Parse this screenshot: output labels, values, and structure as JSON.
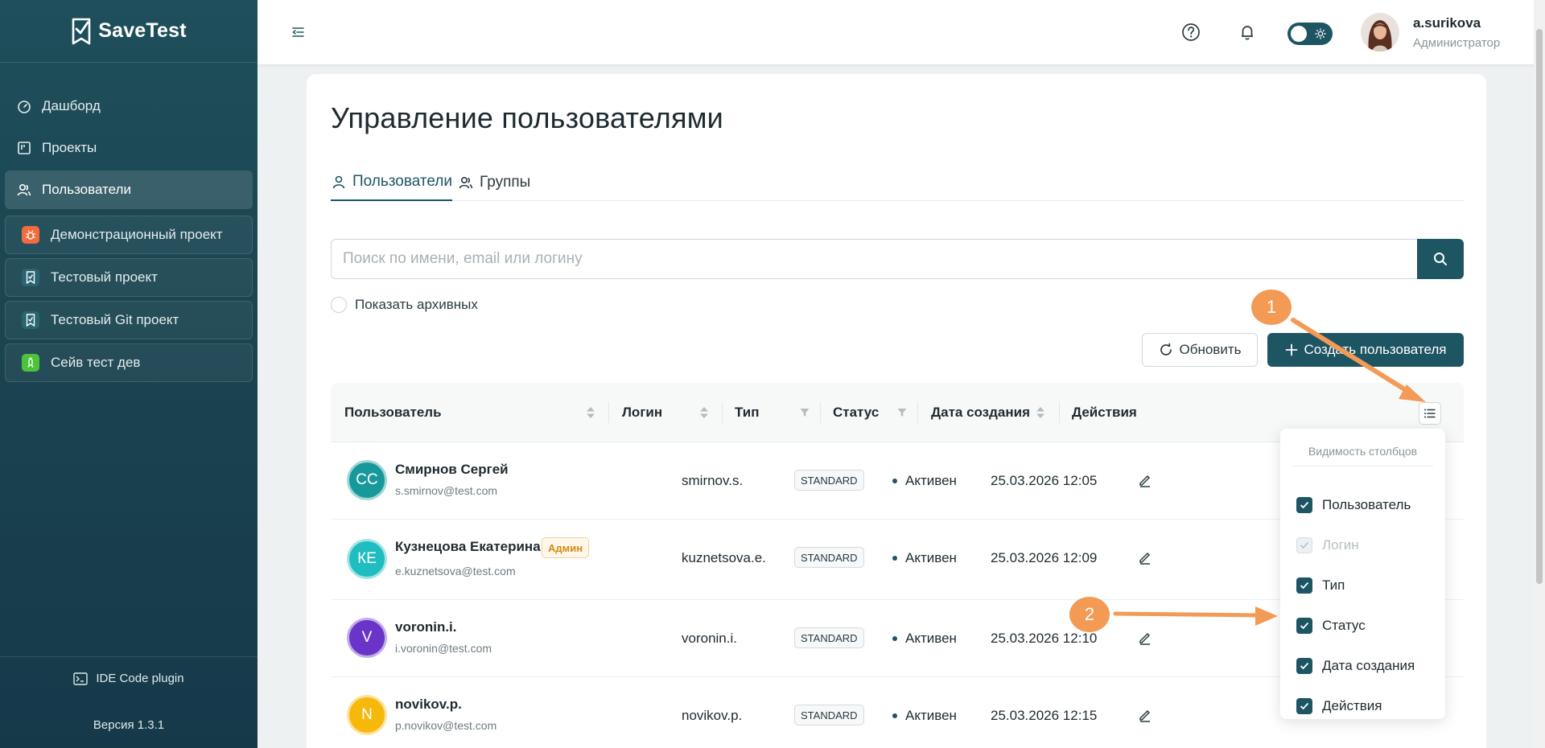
{
  "app": {
    "name": "SaveTest"
  },
  "sidebar": {
    "nav": [
      {
        "label": "Дашборд",
        "icon": "dashboard-icon"
      },
      {
        "label": "Проекты",
        "icon": "kanban-icon"
      },
      {
        "label": "Пользователи",
        "icon": "users-icon",
        "active": true
      }
    ],
    "projects": [
      {
        "label": "Демонстрационный проект",
        "icon": "bug-icon",
        "color": "#f26a3d"
      },
      {
        "label": "Тестовый проект",
        "icon": "checklist-icon",
        "color": "#2a6473"
      },
      {
        "label": "Тестовый Git проект",
        "icon": "checklist-icon",
        "color": "#2a6473"
      },
      {
        "label": "Сейв тест дев",
        "icon": "rocket-icon",
        "color": "#4cc33a"
      }
    ],
    "plugin_label": "IDE Code plugin",
    "version": "Версия 1.3.1"
  },
  "header": {
    "user": {
      "name": "a.surikova",
      "role": "Администратор"
    },
    "theme": "light"
  },
  "page": {
    "title": "Управление пользователями",
    "tabs": [
      {
        "label": "Пользователи",
        "active": true
      },
      {
        "label": "Группы"
      }
    ],
    "search": {
      "placeholder": "Поиск по имени, email или логину",
      "value": ""
    },
    "show_archived_label": "Показать архивных",
    "refresh_label": "Обновить",
    "create_label": "Создать пользователя"
  },
  "table": {
    "columns": [
      "Пользователь",
      "Логин",
      "Тип",
      "Статус",
      "Дата создания",
      "Действия"
    ],
    "rows": [
      {
        "initials": "СС",
        "avatar_color": "#17999b",
        "name": "Смирнов Сергей",
        "email": "s.smirnov@test.com",
        "admin": false,
        "login": "smirnov.s.",
        "type": "STANDARD",
        "status": "Активен",
        "created": "25.03.2026 12:05"
      },
      {
        "initials": "КЕ",
        "avatar_color": "#1fbcc0",
        "name": "Кузнецова Екатерина",
        "email": "e.kuznetsova@test.com",
        "admin": true,
        "admin_label": "Админ",
        "login": "kuznetsova.e.",
        "type": "STANDARD",
        "status": "Активен",
        "created": "25.03.2026 12:09"
      },
      {
        "initials": "V",
        "avatar_color": "#6a34c9",
        "name": "voronin.i.",
        "email": "i.voronin@test.com",
        "admin": false,
        "login": "voronin.i.",
        "type": "STANDARD",
        "status": "Активен",
        "created": "25.03.2026 12:10"
      },
      {
        "initials": "N",
        "avatar_color": "#f6b80b",
        "name": "novikov.p.",
        "email": "p.novikov@test.com",
        "admin": false,
        "login": "novikov.p.",
        "type": "STANDARD",
        "status": "Активен",
        "created": "25.03.2026 12:15"
      }
    ]
  },
  "column_visibility": {
    "title": "Видимость столбцов",
    "items": [
      {
        "label": "Пользователь",
        "checked": true,
        "disabled": false
      },
      {
        "label": "Логин",
        "checked": true,
        "disabled": true
      },
      {
        "label": "Тип",
        "checked": true,
        "disabled": false
      },
      {
        "label": "Статус",
        "checked": true,
        "disabled": false
      },
      {
        "label": "Дата создания",
        "checked": true,
        "disabled": false
      },
      {
        "label": "Действия",
        "checked": true,
        "disabled": false
      }
    ]
  },
  "annotations": [
    {
      "label": "1",
      "color": "#f39a55"
    },
    {
      "label": "2",
      "color": "#f39a55"
    }
  ]
}
